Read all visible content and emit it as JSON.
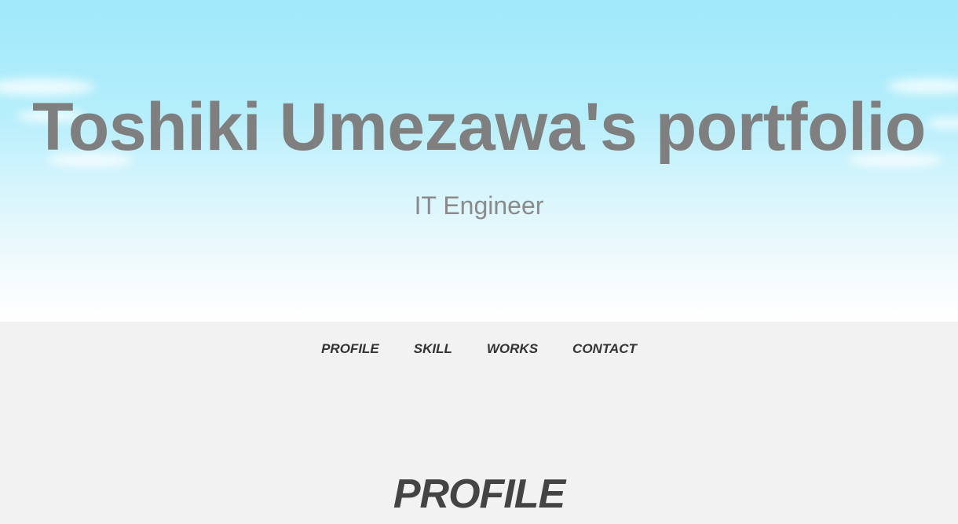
{
  "hero": {
    "title": "Toshiki Umezawa's portfolio",
    "subtitle": "IT Engineer"
  },
  "nav": {
    "items": [
      {
        "label": "PROFILE"
      },
      {
        "label": "SKILL"
      },
      {
        "label": "WORKS"
      },
      {
        "label": "CONTACT"
      }
    ]
  },
  "section": {
    "title": "PROFILE"
  },
  "colors": {
    "sky_top": "#9fe9fb",
    "title_text": "#7f7f7f",
    "nav_text": "#333333",
    "page_background": "#f2f2f2"
  }
}
